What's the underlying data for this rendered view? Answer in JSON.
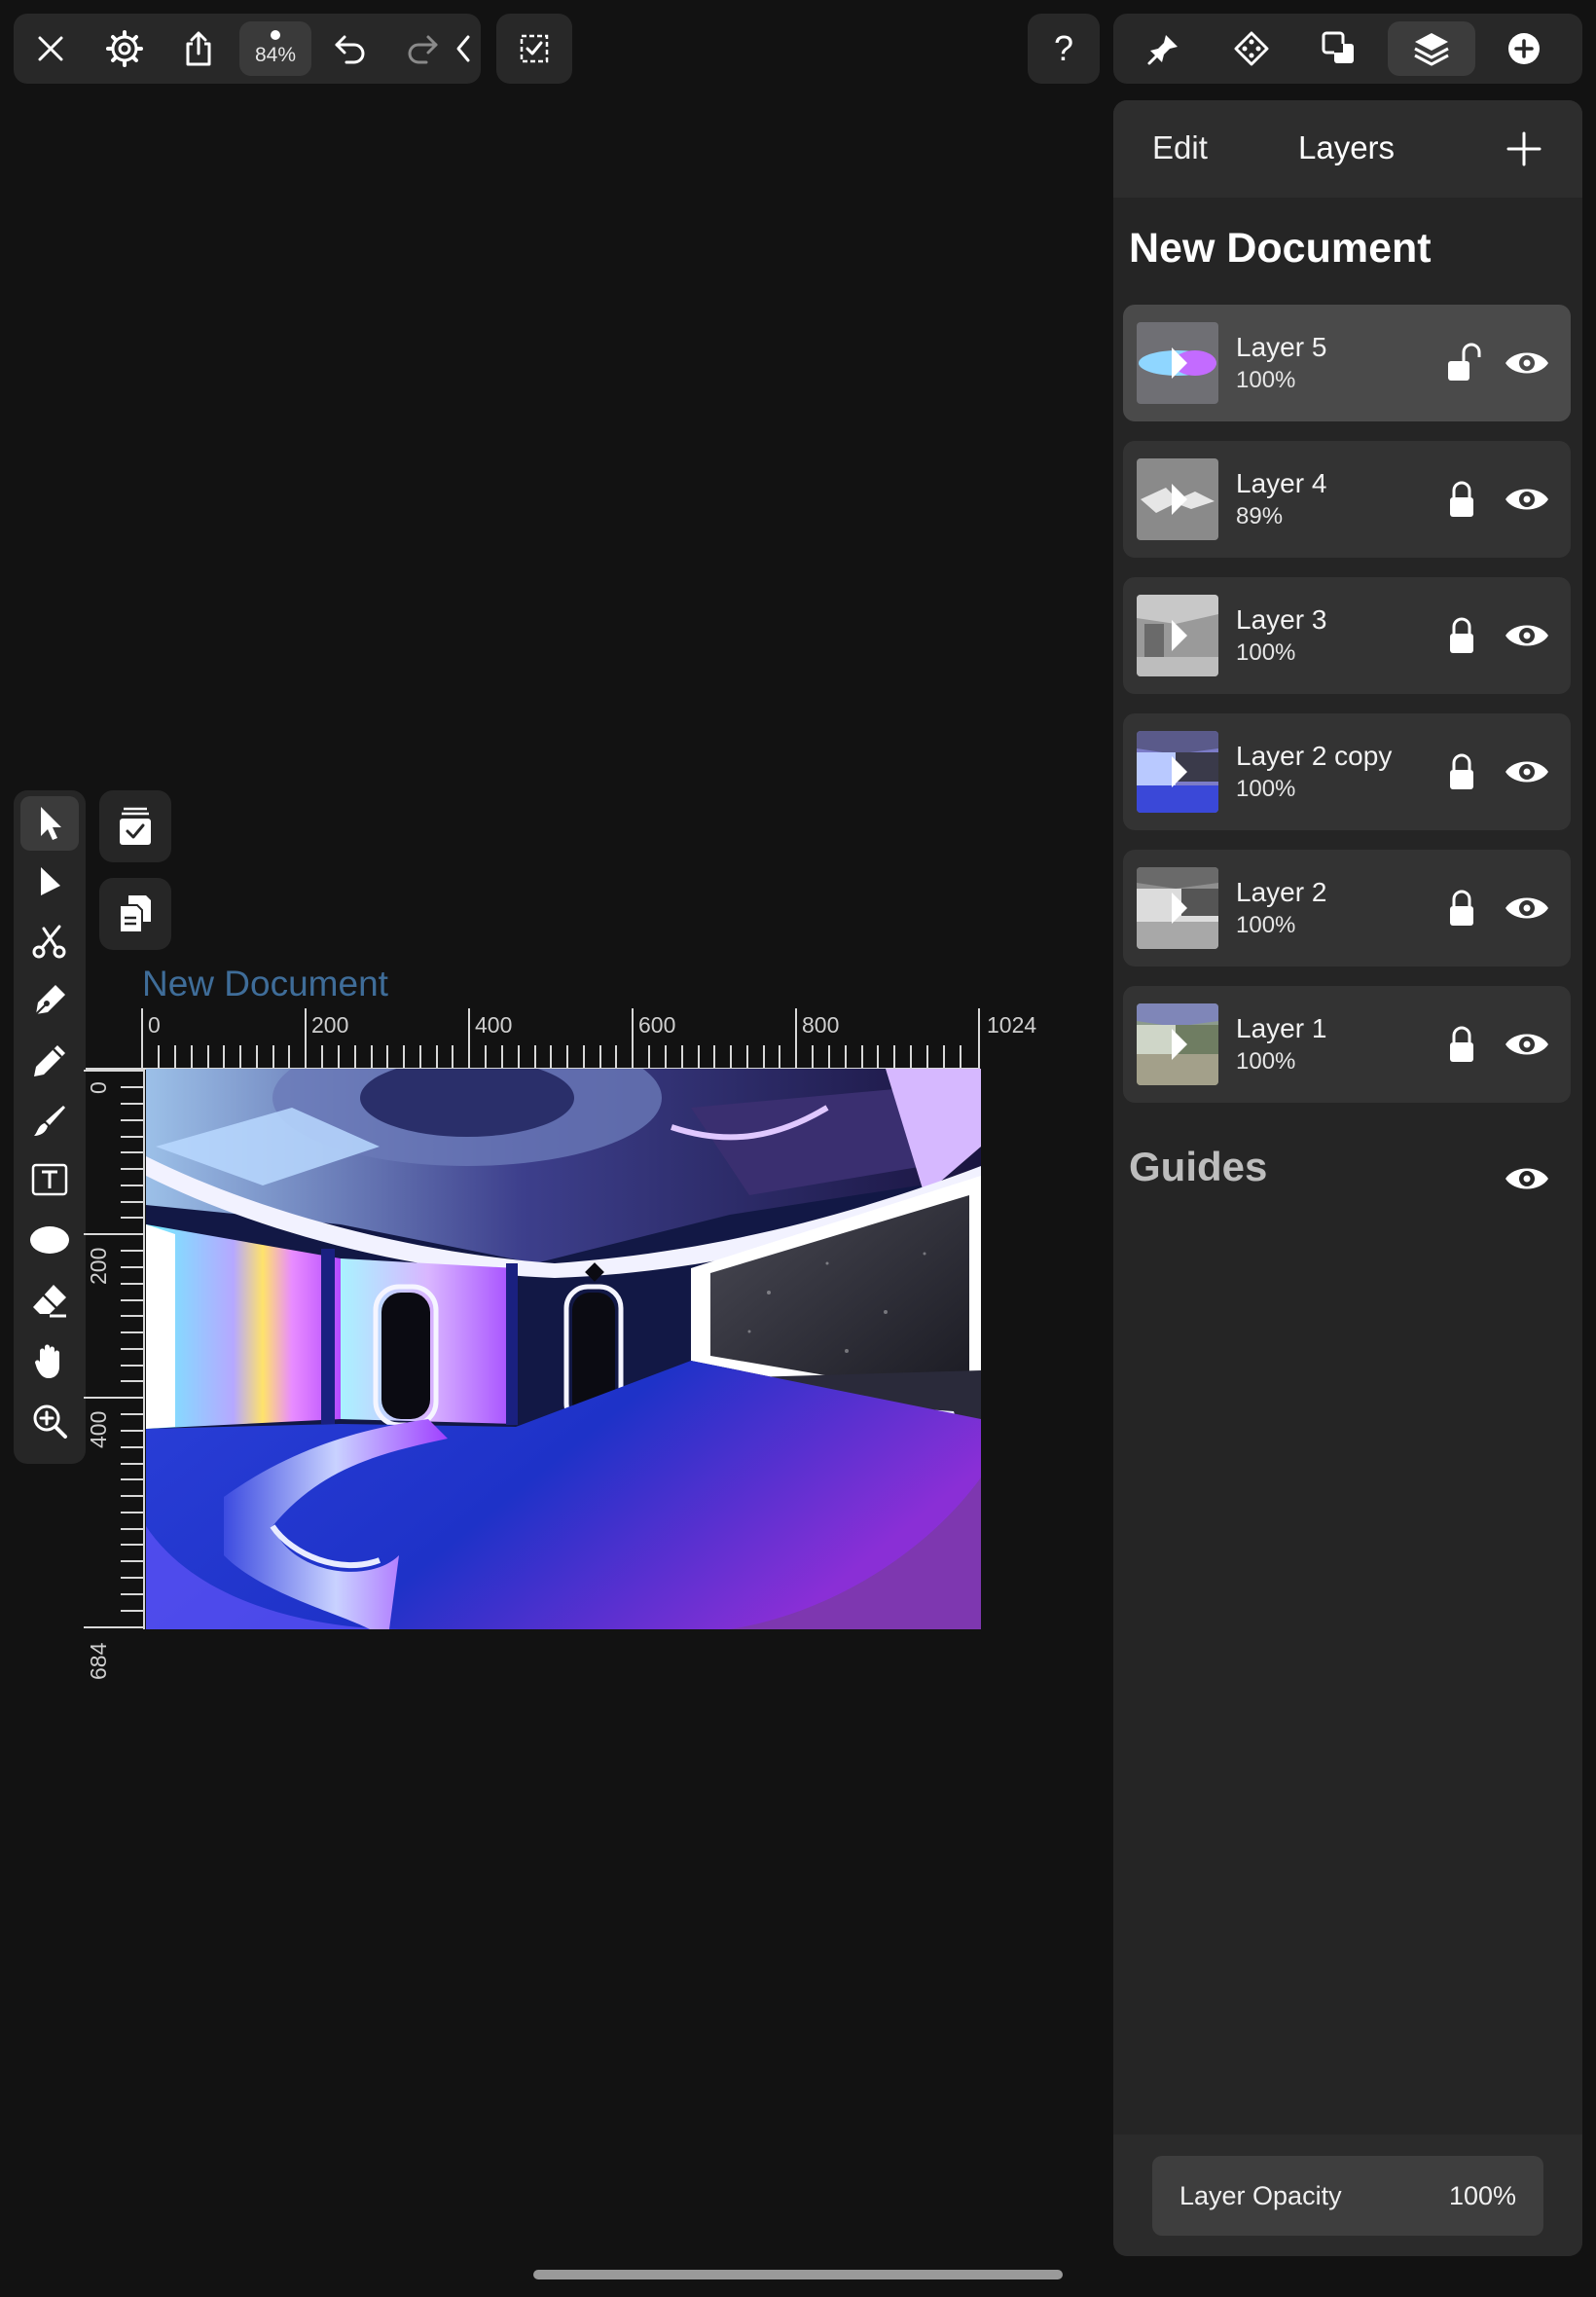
{
  "toolbar": {
    "zoom_label": "84%",
    "help_label": "?"
  },
  "canvas": {
    "document_title": "New Document",
    "ruler_h_labels": [
      "0",
      "200",
      "400",
      "600",
      "800",
      "1024"
    ],
    "ruler_v_labels": [
      "0",
      "200",
      "400",
      "684"
    ]
  },
  "panel": {
    "edit_tab": "Edit",
    "layers_tab": "Layers",
    "document_name": "New Document",
    "layers": [
      {
        "name": "Layer 5",
        "opacity": "100%",
        "locked": false,
        "visible": true,
        "selected": true
      },
      {
        "name": "Layer 4",
        "opacity": "89%",
        "locked": true,
        "visible": true,
        "selected": false
      },
      {
        "name": "Layer 3",
        "opacity": "100%",
        "locked": true,
        "visible": true,
        "selected": false
      },
      {
        "name": "Layer 2 copy",
        "opacity": "100%",
        "locked": true,
        "visible": true,
        "selected": false
      },
      {
        "name": "Layer 2",
        "opacity": "100%",
        "locked": true,
        "visible": true,
        "selected": false
      },
      {
        "name": "Layer 1",
        "opacity": "100%",
        "locked": true,
        "visible": true,
        "selected": false
      }
    ],
    "guides_label": "Guides",
    "opacity_label": "Layer Opacity",
    "opacity_value": "100%"
  },
  "colors": {
    "background": "#121212",
    "panel": "#252525",
    "document_title": "#3f6d99"
  }
}
